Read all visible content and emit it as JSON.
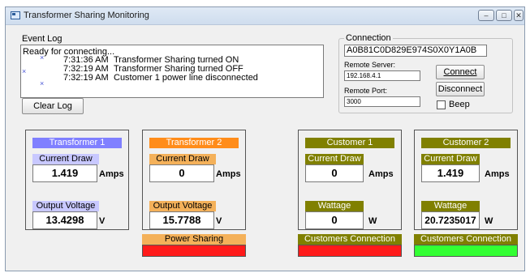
{
  "window": {
    "title": "Transformer Sharing Monitoring",
    "controls": {
      "minimize": "‒",
      "maximize": "□",
      "close": "✕"
    }
  },
  "event_log": {
    "label": "Event Log",
    "status": "Ready for connecting...",
    "entries": [
      {
        "time": "7:31:36 AM",
        "message": "Transformer Sharing turned ON"
      },
      {
        "time": "7:32:19 AM",
        "message": "Transformer Sharing turned OFF"
      },
      {
        "time": "7:32:19 AM",
        "message": "Customer 1 power line disconnected"
      }
    ],
    "clear_label": "Clear Log"
  },
  "connection": {
    "label": "Connection",
    "id_value": "A0B81C0D829E974S0X0Y1A0B",
    "server_label": "Remote Server:",
    "server_value": "192.168.4.1",
    "port_label": "Remote Port:",
    "port_value": "3000",
    "connect_label": "Connect",
    "disconnect_label": "Disconnect",
    "beep_label": "Beep",
    "beep_checked": false
  },
  "transformer1": {
    "title": "Transformer 1",
    "current_label": "Current Draw",
    "current_value": "1.419",
    "current_unit": "Amps",
    "voltage_label": "Output Voltage",
    "voltage_value": "13.4298",
    "voltage_unit": "V",
    "title_color": "#8080ff"
  },
  "transformer2": {
    "title": "Transformer 2",
    "current_label": "Current Draw",
    "current_value": "0",
    "current_unit": "Amps",
    "voltage_label": "Output Voltage",
    "voltage_value": "15.7788",
    "voltage_unit": "V",
    "title_color": "#ff8c1a"
  },
  "power_sharing": {
    "label": "Power Sharing",
    "status_color": "#ff1a1a"
  },
  "customer1": {
    "title": "Customer 1",
    "current_label": "Current Draw",
    "current_value": "0",
    "current_unit": "Amps",
    "wattage_label": "Wattage",
    "wattage_value": "0",
    "wattage_unit": "W",
    "connection_label": "Customers Connection",
    "connection_color": "#ff1a1a",
    "title_color": "#808000"
  },
  "customer2": {
    "title": "Customer 2",
    "current_label": "Current Draw",
    "current_value": "1.419",
    "current_unit": "Amps",
    "wattage_label": "Wattage",
    "wattage_value": "20.7235017",
    "wattage_unit": "W",
    "connection_label": "Customers Connection",
    "connection_color": "#33ff33",
    "title_color": "#808000"
  }
}
